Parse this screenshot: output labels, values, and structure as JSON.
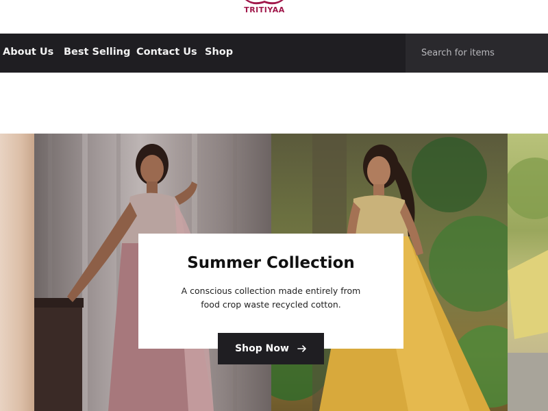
{
  "brand": {
    "name": "TRITIYAA",
    "color": "#a0174a"
  },
  "nav": {
    "items": [
      {
        "label": "About Us"
      },
      {
        "label": "Best Selling"
      },
      {
        "label": "Contact Us"
      },
      {
        "label": "Shop"
      }
    ],
    "search_placeholder": "Search for items",
    "background": "#1f1e22"
  },
  "hero": {
    "title": "Summer Collection",
    "description": "A conscious collection made entirely from food crop waste recycled cotton.",
    "cta_label": "Shop Now",
    "cta_icon": "arrow-right-icon"
  }
}
